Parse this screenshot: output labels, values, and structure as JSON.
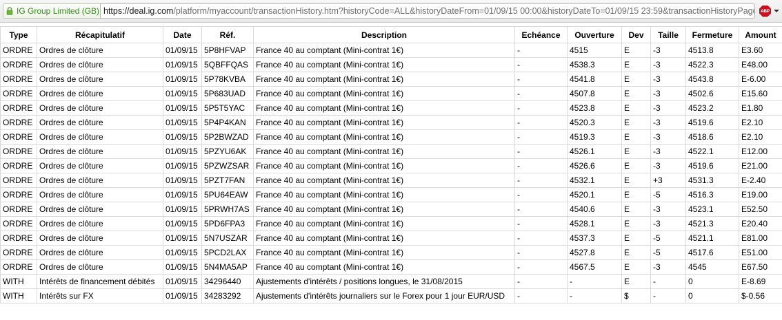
{
  "browser": {
    "identity_label": "IG Group Limited (GB)",
    "url_host": "https://deal.ig.com",
    "url_path": "/platform/myaccount/transactionHistory.htm?historyCode=ALL&historyDateFrom=01/09/15 00:00&historyDateTo=01/09/15 23:59&transactionHistoryPageN",
    "abp_label": "ABP",
    "icons": [
      "lock-icon",
      "adblock-plus-icon",
      "dropdown-arrow-icon"
    ]
  },
  "table": {
    "headers": [
      "Type",
      "Récapitulatif",
      "Date",
      "Réf.",
      "Description",
      "Echéance",
      "Ouverture",
      "Dev",
      "Taille",
      "Fermeture",
      "Amount"
    ],
    "rows": [
      [
        "ORDRE",
        "Ordres de clôture",
        "01/09/15",
        "5P8HFVAP",
        "France 40 au comptant (Mini-contrat 1€)",
        "-",
        "4515",
        "E",
        "-3",
        "4513.8",
        "E3.60"
      ],
      [
        "ORDRE",
        "Ordres de clôture",
        "01/09/15",
        "5QBFFQAS",
        "France 40 au comptant (Mini-contrat 1€)",
        "-",
        "4538.3",
        "E",
        "-3",
        "4522.3",
        "E48.00"
      ],
      [
        "ORDRE",
        "Ordres de clôture",
        "01/09/15",
        "5P78KVBA",
        "France 40 au comptant (Mini-contrat 1€)",
        "-",
        "4541.8",
        "E",
        "-3",
        "4543.8",
        "E-6.00"
      ],
      [
        "ORDRE",
        "Ordres de clôture",
        "01/09/15",
        "5P683UAD",
        "France 40 au comptant (Mini-contrat 1€)",
        "-",
        "4507.8",
        "E",
        "-3",
        "4502.6",
        "E15.60"
      ],
      [
        "ORDRE",
        "Ordres de clôture",
        "01/09/15",
        "5P5T5YAC",
        "France 40 au comptant (Mini-contrat 1€)",
        "-",
        "4523.8",
        "E",
        "-3",
        "4523.2",
        "E1.80"
      ],
      [
        "ORDRE",
        "Ordres de clôture",
        "01/09/15",
        "5P4P4KAN",
        "France 40 au comptant (Mini-contrat 1€)",
        "-",
        "4520.3",
        "E",
        "-3",
        "4519.6",
        "E2.10"
      ],
      [
        "ORDRE",
        "Ordres de clôture",
        "01/09/15",
        "5P2BWZAD",
        "France 40 au comptant (Mini-contrat 1€)",
        "-",
        "4519.3",
        "E",
        "-3",
        "4518.6",
        "E2.10"
      ],
      [
        "ORDRE",
        "Ordres de clôture",
        "01/09/15",
        "5PZYU6AK",
        "France 40 au comptant (Mini-contrat 1€)",
        "-",
        "4526.1",
        "E",
        "-3",
        "4522.1",
        "E12.00"
      ],
      [
        "ORDRE",
        "Ordres de clôture",
        "01/09/15",
        "5PZWZSAR",
        "France 40 au comptant (Mini-contrat 1€)",
        "-",
        "4526.6",
        "E",
        "-3",
        "4519.6",
        "E21.00"
      ],
      [
        "ORDRE",
        "Ordres de clôture",
        "01/09/15",
        "5PZT7FAN",
        "France 40 au comptant (Mini-contrat 1€)",
        "-",
        "4532.1",
        "E",
        "+3",
        "4531.3",
        "E-2.40"
      ],
      [
        "ORDRE",
        "Ordres de clôture",
        "01/09/15",
        "5PU64EAW",
        "France 40 au comptant (Mini-contrat 1€)",
        "-",
        "4520.1",
        "E",
        "-5",
        "4516.3",
        "E19.00"
      ],
      [
        "ORDRE",
        "Ordres de clôture",
        "01/09/15",
        "5PRWH7AS",
        "France 40 au comptant (Mini-contrat 1€)",
        "-",
        "4540.6",
        "E",
        "-3",
        "4523.1",
        "E52.50"
      ],
      [
        "ORDRE",
        "Ordres de clôture",
        "01/09/15",
        "5PD6FPA3",
        "France 40 au comptant (Mini-contrat 1€)",
        "-",
        "4528.1",
        "E",
        "-3",
        "4521.3",
        "E20.40"
      ],
      [
        "ORDRE",
        "Ordres de clôture",
        "01/09/15",
        "5N7USZAR",
        "France 40 au comptant (Mini-contrat 1€)",
        "-",
        "4537.3",
        "E",
        "-5",
        "4521.1",
        "E81.00"
      ],
      [
        "ORDRE",
        "Ordres de clôture",
        "01/09/15",
        "5PCD2LAX",
        "France 40 au comptant (Mini-contrat 1€)",
        "-",
        "4527.8",
        "E",
        "-5",
        "4517.6",
        "E51.00"
      ],
      [
        "ORDRE",
        "Ordres de clôture",
        "01/09/15",
        "5N4MA5AP",
        "France 40 au comptant (Mini-contrat 1€)",
        "-",
        "4567.5",
        "E",
        "-3",
        "4545",
        "E67.50"
      ],
      [
        "WITH",
        "Intérêts de financement débités",
        "01/09/15",
        "34296440",
        "Ajustements d'intérêts / positions longues, le 31/08/2015",
        "-",
        "-",
        "E",
        "-",
        "0",
        "E-8.69"
      ],
      [
        "WITH",
        "Intérêts sur FX",
        "01/09/15",
        "34283292",
        "Ajustements d'intérêts journaliers sur le Forex pour 1 jour EUR/USD",
        "-",
        "-",
        "$",
        "-",
        "0",
        "$-0.56"
      ]
    ]
  },
  "colors": {
    "identity_green": "#3b8a1d",
    "abp_red": "#c7121f",
    "grid_line": "#d9d9d9"
  }
}
